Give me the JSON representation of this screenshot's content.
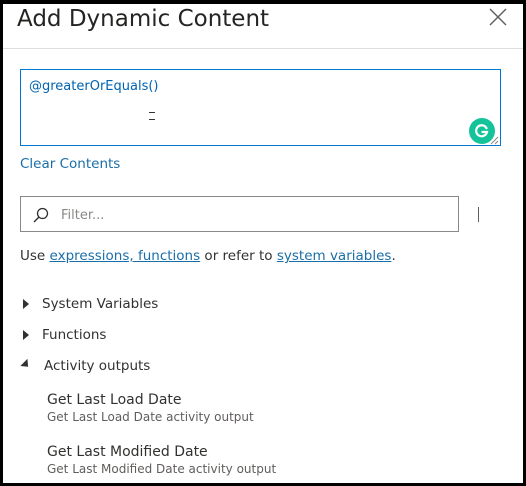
{
  "dialog": {
    "title": "Add Dynamic Content",
    "close_icon": "close-icon"
  },
  "editor": {
    "value": "@greaterOrEquals()",
    "assistant_icon": "grammarly-icon",
    "assistant_color": "#15c39a"
  },
  "clear_contents": "Clear Contents",
  "filter": {
    "placeholder": "Filter...",
    "icon": "search-icon"
  },
  "helper": {
    "prefix": "Use ",
    "link1": "expressions, functions",
    "middle": " or refer to ",
    "link2": "system variables",
    "suffix": "."
  },
  "tree": {
    "items": [
      {
        "label": "System Variables",
        "expanded": false
      },
      {
        "label": "Functions",
        "expanded": false
      },
      {
        "label": "Activity outputs",
        "expanded": true
      }
    ],
    "outputs": [
      {
        "name": "Get Last Load Date",
        "description": "Get Last Load Date activity output"
      },
      {
        "name": "Get Last Modified Date",
        "description": "Get Last Modified Date activity output"
      }
    ]
  },
  "colors": {
    "accent": "#0078d4",
    "link": "#1a6ea8"
  }
}
